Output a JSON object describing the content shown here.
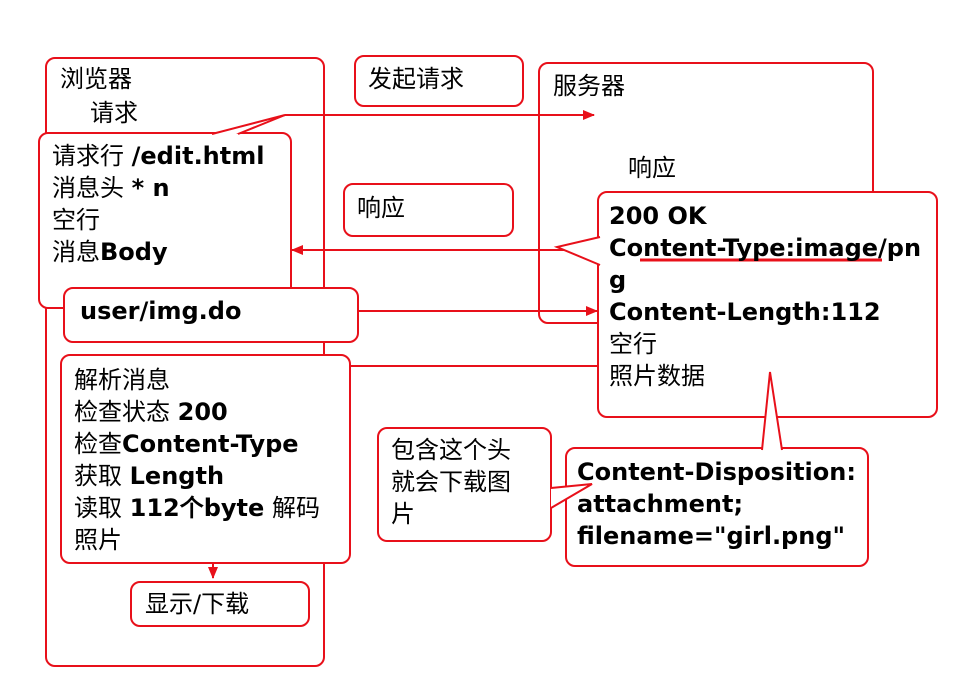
{
  "browser": {
    "title": "浏览器",
    "request_label": "请求"
  },
  "server": {
    "title": "服务器",
    "response_label": "响应"
  },
  "send_request": {
    "label": "发起请求"
  },
  "response_note": {
    "label": "响应"
  },
  "request_message": {
    "line1_prefix": "请求行 ",
    "line1_path": "/edit.html",
    "line2_prefix": "消息头 ",
    "line2_suffix": "* n",
    "line3": "空行",
    "line4_prefix": "消息",
    "line4_suffix": "Body"
  },
  "url_box": {
    "label": "user/img.do"
  },
  "response_message": {
    "status": "200  OK",
    "content_type_a": "Content-Type:image/pn",
    "content_type_b": "g",
    "content_length": "Content-Length:112",
    "blank_line": "空行",
    "photo_data": "照片数据"
  },
  "parse": {
    "line1": "解析消息",
    "line2_prefix": "检查状态 ",
    "line2_value": "200",
    "line3_prefix": "检查",
    "line3_value": "Content-Type",
    "line4_prefix": "获取 ",
    "line4_value": "Length",
    "line5_prefix": "读取 ",
    "line5_value": "112个byte",
    "line5_suffix": " 解码",
    "line6": "照片"
  },
  "display": {
    "label": "显示/下载"
  },
  "header_note": {
    "line1": "包含这个头",
    "line2": "就会下载图",
    "line3": "片"
  },
  "disposition": {
    "line1": "Content-Disposition:",
    "line2": "attachment;",
    "line3": "filename=\"girl.png\""
  },
  "colors": {
    "accent": "#e8101a",
    "text": "#000000"
  }
}
